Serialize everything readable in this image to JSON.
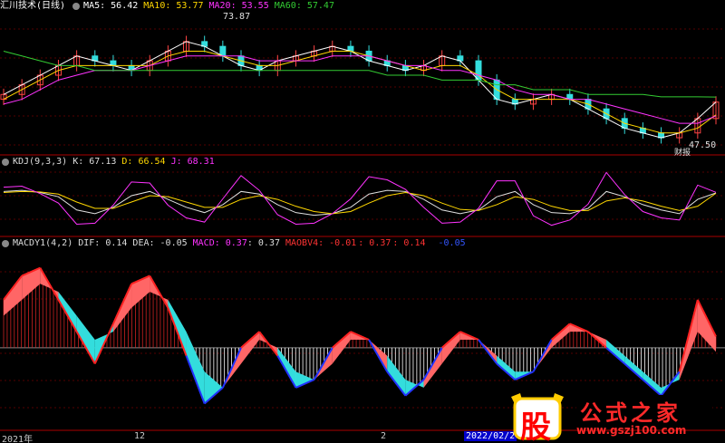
{
  "main": {
    "title": "汇川技术(日线)",
    "ma": [
      {
        "label": "MA5: 56.42",
        "color": "#ffffff"
      },
      {
        "label": "MA10: 53.77",
        "color": "#ffd700"
      },
      {
        "label": "MA20: 53.55",
        "color": "#ff33ff"
      },
      {
        "label": "MA60: 57.47",
        "color": "#33cc33"
      }
    ],
    "high_label": "73.87",
    "low_label": "47.50",
    "note": "财报"
  },
  "kdj": {
    "title": "KDJ(9,3,3)",
    "k": "K: 67.13",
    "d": "D: 66.54",
    "j": "J: 68.31"
  },
  "macd": {
    "title": "MACDY1(4,2)",
    "dif": "DIF: 0.14",
    "dea": "DEA: -0.05",
    "macd": "MACD: 0.37",
    "macd_val": ": 0.37",
    "maobv": "MAOBV4: -0.01",
    "v1": ": 0.37",
    "v2": ": 0.14",
    "v3": "-0.05"
  },
  "x_axis": {
    "labels": [
      "2021年",
      "12",
      "2",
      "2022/02/2"
    ]
  },
  "watermark": {
    "left": "股",
    "right": "公式之家",
    "url": "www.gszj100.com"
  },
  "chart_data": {
    "type": "line",
    "title": "汇川技术(日线)",
    "x": [
      0,
      1,
      2,
      3,
      4,
      5,
      6,
      7,
      8,
      9,
      10,
      11,
      12,
      13,
      14,
      15,
      16,
      17,
      18,
      19,
      20,
      21,
      22,
      23,
      24,
      25,
      26,
      27,
      28,
      29,
      30,
      31,
      32,
      33,
      34,
      35,
      36,
      37,
      38,
      39
    ],
    "series": [
      {
        "name": "MA5",
        "values": [
          58,
          60,
          62,
          64,
          66,
          65,
          64,
          63,
          65,
          67,
          69,
          68,
          66,
          64,
          63,
          65,
          66,
          67,
          68,
          67,
          65,
          64,
          63,
          64,
          66,
          65,
          61,
          57,
          56,
          57,
          58,
          57,
          55,
          53,
          51,
          50,
          49,
          50,
          53,
          56.42
        ]
      },
      {
        "name": "MA10",
        "values": [
          57,
          59,
          61,
          63,
          64,
          64,
          64,
          64,
          64,
          66,
          67,
          67,
          66,
          65,
          64,
          64,
          65,
          66,
          67,
          67,
          66,
          65,
          64,
          63,
          64,
          64,
          62,
          59,
          57,
          57,
          57,
          57,
          56,
          54,
          52,
          51,
          50,
          50,
          51,
          53.77
        ]
      },
      {
        "name": "MA20",
        "values": [
          56,
          57,
          59,
          61,
          62,
          63,
          63,
          63,
          64,
          65,
          66,
          66,
          66,
          66,
          65,
          65,
          65,
          65,
          66,
          66,
          66,
          65,
          64,
          64,
          63,
          63,
          62,
          61,
          59,
          58,
          58,
          57,
          57,
          56,
          55,
          54,
          53,
          52,
          52,
          53.55
        ]
      },
      {
        "name": "MA60",
        "values": [
          67,
          66,
          65,
          64,
          64,
          63,
          63,
          63,
          63,
          63,
          63,
          63,
          63,
          63,
          63,
          63,
          63,
          63,
          63,
          63,
          63,
          62,
          62,
          62,
          61,
          61,
          61,
          60,
          60,
          59,
          59,
          59,
          58,
          58,
          58,
          58,
          57.5,
          57.5,
          57.5,
          57.47
        ]
      }
    ],
    "ylim": [
      46,
      75
    ],
    "kdj": {
      "K": [
        70,
        72,
        68,
        60,
        35,
        28,
        40,
        62,
        70,
        55,
        40,
        30,
        45,
        70,
        65,
        45,
        30,
        25,
        28,
        40,
        65,
        72,
        70,
        55,
        35,
        28,
        35,
        60,
        70,
        45,
        30,
        28,
        38,
        70,
        60,
        45,
        35,
        28,
        55,
        67.13
      ],
      "D": [
        68,
        70,
        69,
        65,
        50,
        38,
        38,
        50,
        62,
        60,
        50,
        40,
        40,
        55,
        62,
        55,
        42,
        32,
        28,
        32,
        48,
        62,
        68,
        62,
        48,
        36,
        34,
        45,
        60,
        55,
        42,
        34,
        34,
        52,
        58,
        52,
        42,
        34,
        42,
        66.54
      ],
      "J": [
        78,
        80,
        66,
        48,
        8,
        10,
        44,
        88,
        86,
        44,
        20,
        12,
        56,
        100,
        72,
        26,
        8,
        10,
        28,
        56,
        98,
        92,
        74,
        40,
        10,
        12,
        38,
        90,
        90,
        24,
        6,
        16,
        46,
        106,
        64,
        32,
        20,
        16,
        82,
        68.31
      ],
      "ylim": [
        -10,
        110
      ]
    },
    "macd": {
      "DIF": [
        0.6,
        0.9,
        1.0,
        0.6,
        0.2,
        -0.2,
        0.3,
        0.8,
        0.9,
        0.5,
        -0.1,
        -0.7,
        -0.5,
        0.0,
        0.2,
        -0.1,
        -0.5,
        -0.4,
        0.0,
        0.2,
        0.1,
        -0.3,
        -0.6,
        -0.4,
        0.0,
        0.2,
        0.1,
        -0.2,
        -0.4,
        -0.3,
        0.1,
        0.3,
        0.2,
        0.0,
        -0.2,
        -0.4,
        -0.6,
        -0.3,
        0.6,
        0.14
      ],
      "DEA": [
        0.4,
        0.6,
        0.8,
        0.7,
        0.4,
        0.1,
        0.2,
        0.5,
        0.7,
        0.6,
        0.2,
        -0.3,
        -0.5,
        -0.2,
        0.1,
        0.0,
        -0.3,
        -0.4,
        -0.2,
        0.1,
        0.1,
        -0.1,
        -0.4,
        -0.5,
        -0.2,
        0.1,
        0.1,
        -0.1,
        -0.3,
        -0.3,
        0.0,
        0.2,
        0.2,
        0.1,
        -0.1,
        -0.3,
        -0.5,
        -0.4,
        0.2,
        -0.05
      ],
      "ylim": [
        -1.0,
        1.2
      ]
    }
  }
}
